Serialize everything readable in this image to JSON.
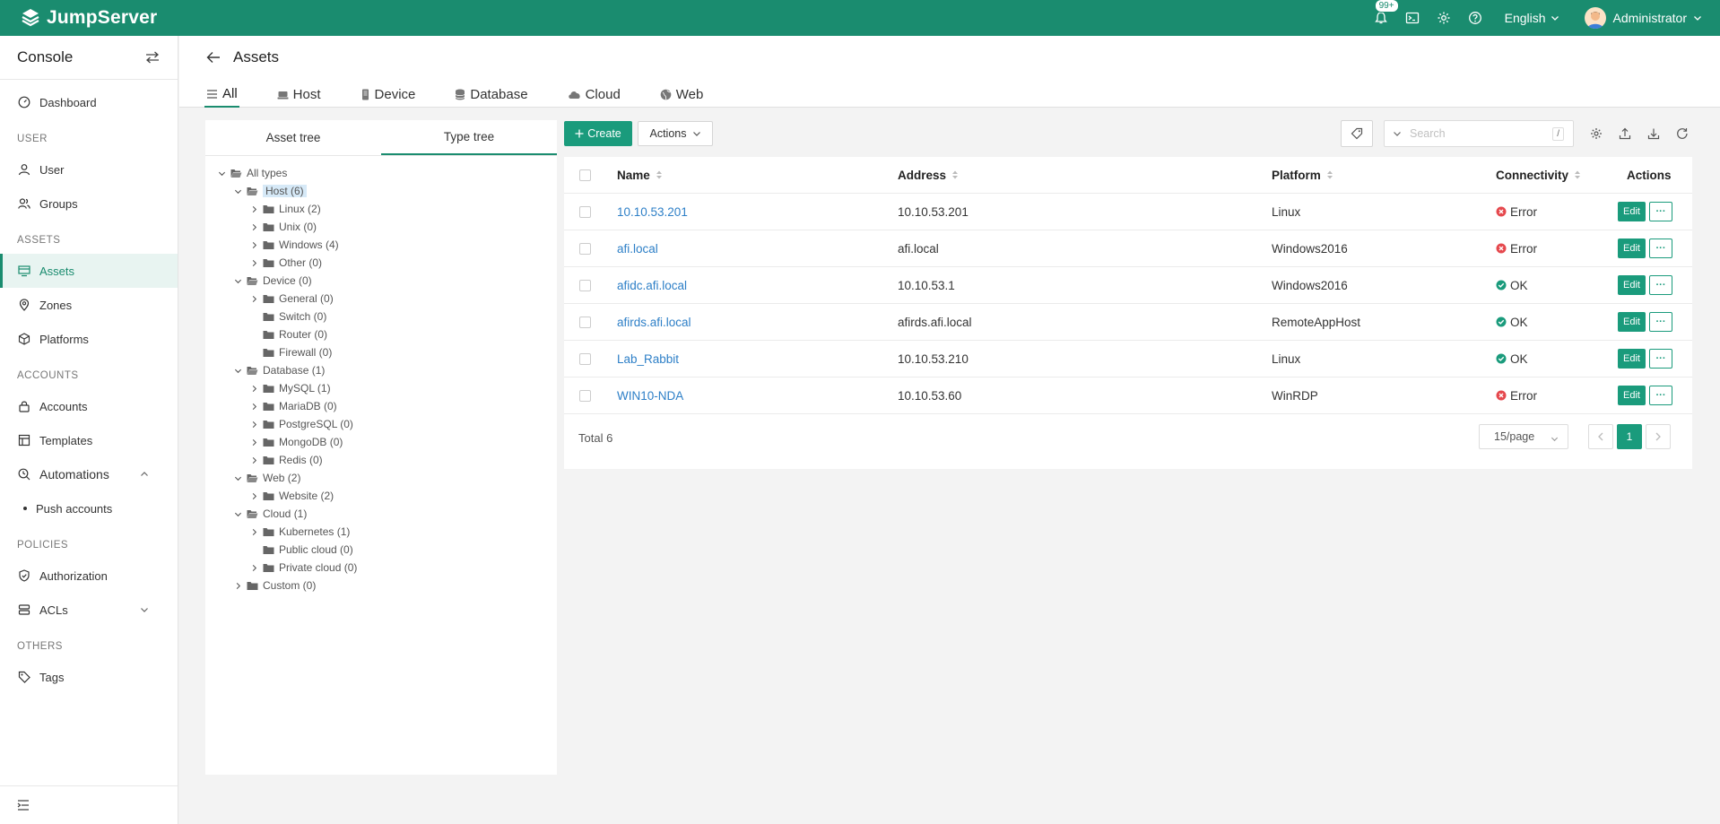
{
  "app": {
    "name": "JumpServer",
    "brand_color": "#1a8c6f"
  },
  "topbar": {
    "notification_badge": "99+",
    "icons": [
      "bell-icon",
      "terminal-icon",
      "gear-icon",
      "help-icon"
    ],
    "language": "English",
    "user": "Administrator"
  },
  "sidebar": {
    "title": "Console",
    "sections": {
      "user": "USER",
      "assets": "ASSETS",
      "accounts": "ACCOUNTS",
      "policies": "POLICIES",
      "others": "OTHERS"
    },
    "items": {
      "dashboard": "Dashboard",
      "user": "User",
      "groups": "Groups",
      "assets": "Assets",
      "zones": "Zones",
      "platforms": "Platforms",
      "accounts": "Accounts",
      "templates": "Templates",
      "automations": "Automations",
      "push_accounts": "Push accounts",
      "authorization": "Authorization",
      "acls": "ACLs",
      "tags": "Tags"
    }
  },
  "page": {
    "title": "Assets",
    "tabs": [
      "All",
      "Host",
      "Device",
      "Database",
      "Cloud",
      "Web"
    ],
    "active_tab": "All"
  },
  "tree": {
    "tabs": [
      "Asset tree",
      "Type tree"
    ],
    "active_tab": "Type tree",
    "nodes": [
      {
        "label": "All types",
        "level": 0,
        "expanded": true,
        "has_children": true
      },
      {
        "label": "Host (6)",
        "level": 1,
        "expanded": true,
        "has_children": true,
        "selected": true
      },
      {
        "label": "Linux (2)",
        "level": 2,
        "expanded": false,
        "has_children": true
      },
      {
        "label": "Unix (0)",
        "level": 2,
        "expanded": false,
        "has_children": true
      },
      {
        "label": "Windows (4)",
        "level": 2,
        "expanded": false,
        "has_children": true
      },
      {
        "label": "Other (0)",
        "level": 2,
        "expanded": false,
        "has_children": true
      },
      {
        "label": "Device (0)",
        "level": 1,
        "expanded": true,
        "has_children": true
      },
      {
        "label": "General (0)",
        "level": 2,
        "expanded": false,
        "has_children": true
      },
      {
        "label": "Switch (0)",
        "level": 2,
        "expanded": false,
        "has_children": false
      },
      {
        "label": "Router (0)",
        "level": 2,
        "expanded": false,
        "has_children": false
      },
      {
        "label": "Firewall (0)",
        "level": 2,
        "expanded": false,
        "has_children": false
      },
      {
        "label": "Database (1)",
        "level": 1,
        "expanded": true,
        "has_children": true
      },
      {
        "label": "MySQL (1)",
        "level": 2,
        "expanded": false,
        "has_children": true
      },
      {
        "label": "MariaDB (0)",
        "level": 2,
        "expanded": false,
        "has_children": true
      },
      {
        "label": "PostgreSQL (0)",
        "level": 2,
        "expanded": false,
        "has_children": true
      },
      {
        "label": "MongoDB (0)",
        "level": 2,
        "expanded": false,
        "has_children": true
      },
      {
        "label": "Redis (0)",
        "level": 2,
        "expanded": false,
        "has_children": true
      },
      {
        "label": "Web (2)",
        "level": 1,
        "expanded": true,
        "has_children": true
      },
      {
        "label": "Website (2)",
        "level": 2,
        "expanded": false,
        "has_children": true
      },
      {
        "label": "Cloud (1)",
        "level": 1,
        "expanded": true,
        "has_children": true
      },
      {
        "label": "Kubernetes (1)",
        "level": 2,
        "expanded": false,
        "has_children": true
      },
      {
        "label": "Public cloud (0)",
        "level": 2,
        "expanded": false,
        "has_children": false
      },
      {
        "label": "Private cloud (0)",
        "level": 2,
        "expanded": false,
        "has_children": true
      },
      {
        "label": "Custom (0)",
        "level": 1,
        "expanded": false,
        "has_children": true
      }
    ]
  },
  "toolbar": {
    "create_label": "Create",
    "actions_label": "Actions",
    "search_placeholder": "Search",
    "search_shortcut": "/"
  },
  "table": {
    "columns": [
      "Name",
      "Address",
      "Platform",
      "Connectivity",
      "Actions"
    ],
    "rows": [
      {
        "name": "10.10.53.201",
        "address": "10.10.53.201",
        "platform": "Linux",
        "connectivity": "Error"
      },
      {
        "name": "afi.local",
        "address": "afi.local",
        "platform": "Windows2016",
        "connectivity": "Error"
      },
      {
        "name": "afidc.afi.local",
        "address": "10.10.53.1",
        "platform": "Windows2016",
        "connectivity": "OK"
      },
      {
        "name": "afirds.afi.local",
        "address": "afirds.afi.local",
        "platform": "RemoteAppHost",
        "connectivity": "OK"
      },
      {
        "name": "Lab_Rabbit",
        "address": "10.10.53.210",
        "platform": "Linux",
        "connectivity": "OK"
      },
      {
        "name": "WIN10-NDA",
        "address": "10.10.53.60",
        "platform": "WinRDP",
        "connectivity": "Error"
      }
    ],
    "edit_label": "Edit",
    "more_label": "···",
    "status_colors": {
      "Error": "#e5484d",
      "OK": "#1a9b7c"
    }
  },
  "pagination": {
    "total_label": "Total 6",
    "page_size": "15/page",
    "current_page": "1"
  }
}
